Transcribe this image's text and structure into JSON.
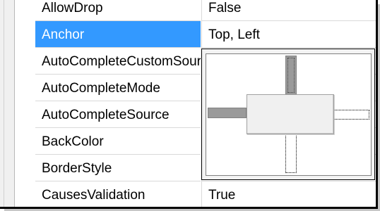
{
  "properties": [
    {
      "name": "AllowDrop",
      "value": "False"
    },
    {
      "name": "Anchor",
      "value": "Top, Left",
      "selected": true
    },
    {
      "name": "AutoCompleteCustomSource",
      "value": ""
    },
    {
      "name": "AutoCompleteMode",
      "value": ""
    },
    {
      "name": "AutoCompleteSource",
      "value": ""
    },
    {
      "name": "BackColor",
      "value": ""
    },
    {
      "name": "BorderStyle",
      "value": ""
    },
    {
      "name": "CausesValidation",
      "value": "True"
    }
  ],
  "anchor_editor": {
    "top": true,
    "left": true,
    "right": false,
    "bottom": false
  },
  "colors": {
    "selection": "#3399ff",
    "selected_text": "#ffffff",
    "grid_line": "#d9d9d9",
    "active_anchor": "#9a9a9a"
  }
}
